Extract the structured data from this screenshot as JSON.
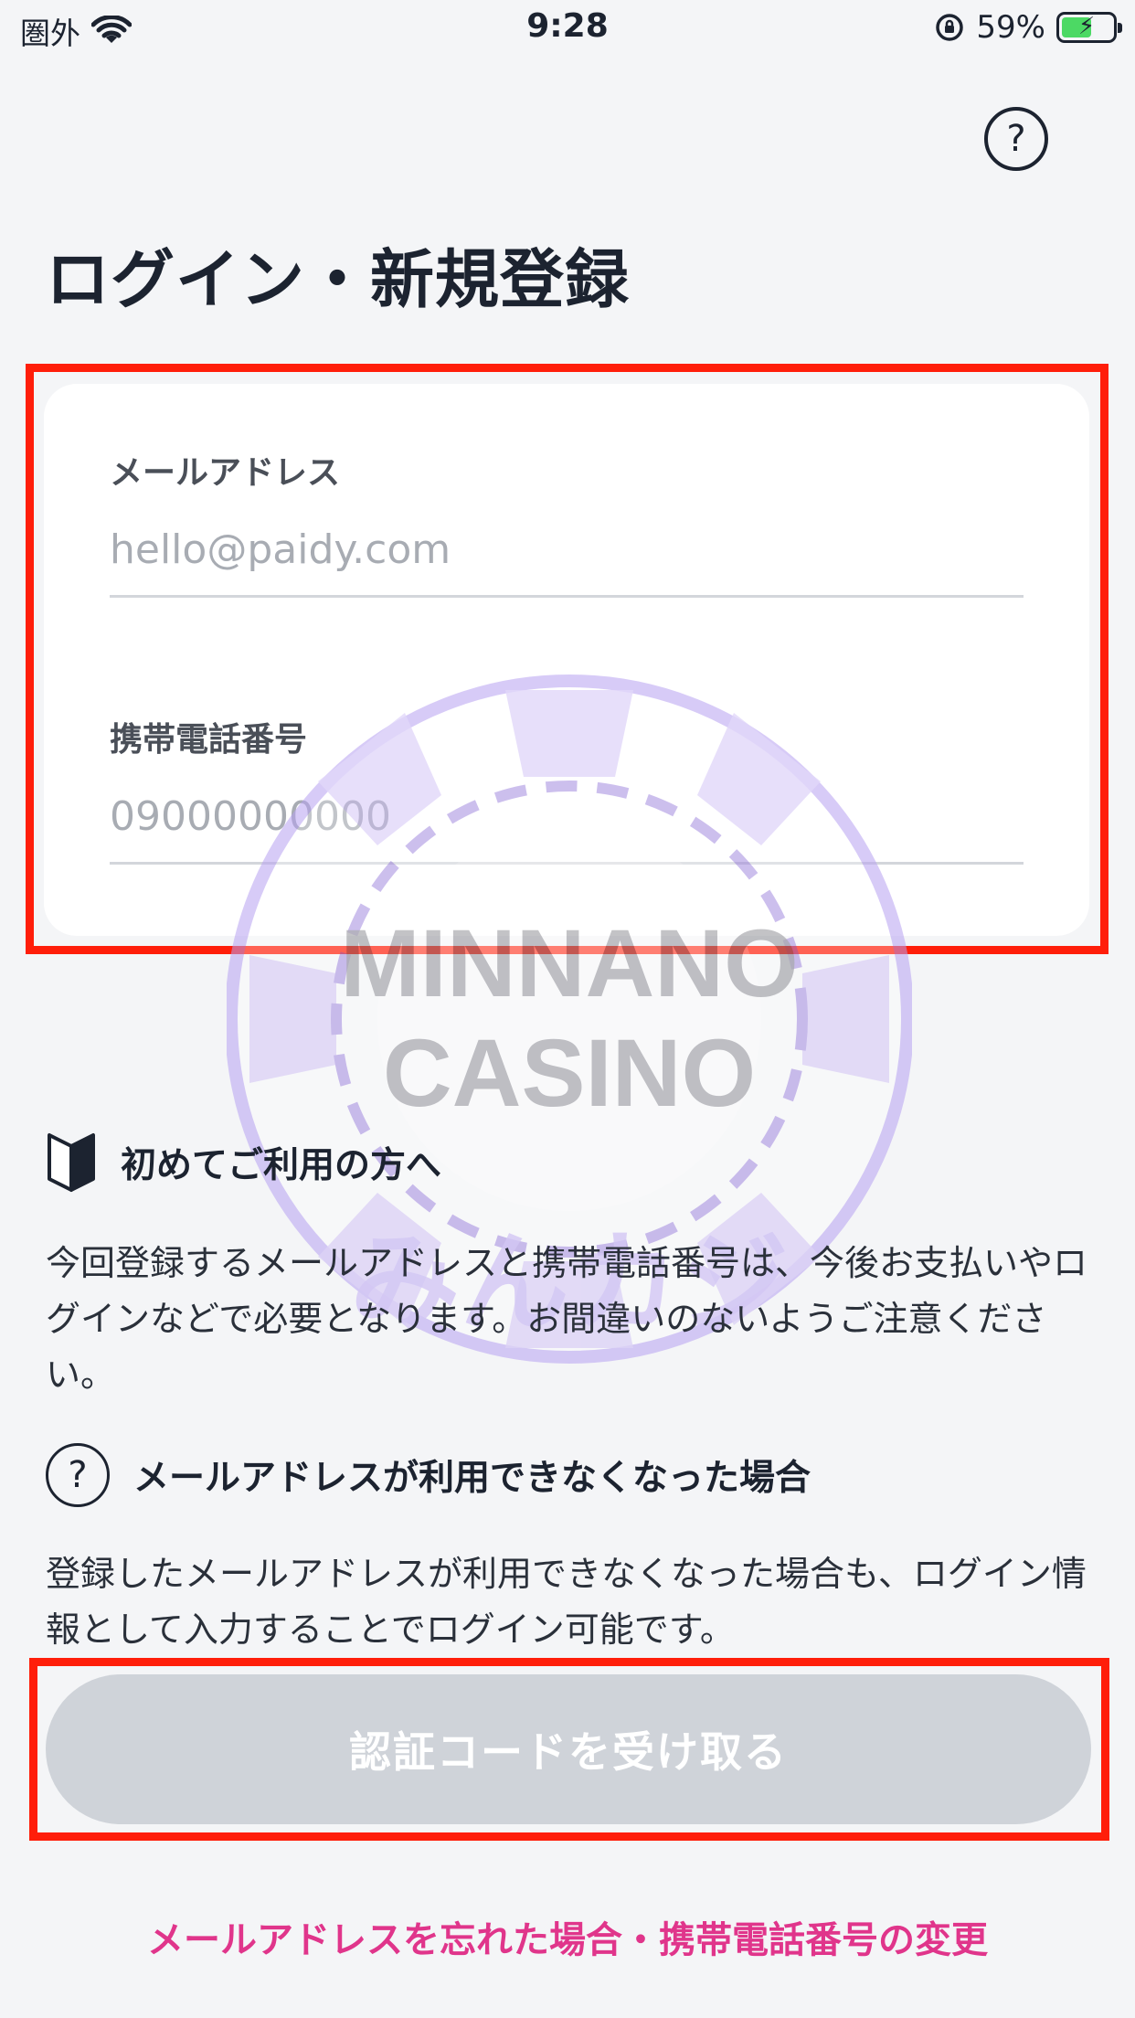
{
  "status_bar": {
    "carrier": "圏外",
    "time": "9:28",
    "battery_percent": "59%",
    "battery_level": 0.59,
    "battery_color": "#4cd964"
  },
  "header": {
    "help_icon": "question-circle-icon",
    "help_glyph": "?",
    "title": "ログイン・新規登録"
  },
  "form": {
    "email": {
      "label": "メールアドレス",
      "placeholder": "hello@paidy.com",
      "value": ""
    },
    "phone": {
      "label": "携帯電話番号",
      "placeholder": "09000000000",
      "value": ""
    }
  },
  "watermark": {
    "line1": "MINNANO",
    "line2": "CASINO",
    "line3": "みんカジ",
    "color": "#b8a2f2"
  },
  "info": {
    "first_time": {
      "icon": "beginner-mark-icon",
      "heading": "初めてご利用の方へ",
      "body": "今回登録するメールアドレスと携帯電話番号は、今後お支払いやログインなどで必要となります。お間違いのないようご注意ください。"
    },
    "email_unavailable": {
      "icon": "question-circle-icon",
      "glyph": "?",
      "heading": "メールアドレスが利用できなくなった場合",
      "body": "登録したメールアドレスが利用できなくなった場合も、ログイン情報として入力することでログイン可能です。"
    }
  },
  "actions": {
    "submit_label": "認証コードを受け取る",
    "submit_color": "#cfd3d9",
    "forgot_link": "メールアドレスを忘れた場合・携帯電話番号の変更",
    "link_color": "#e0358b"
  },
  "annotation_color": "#ff1e0a"
}
